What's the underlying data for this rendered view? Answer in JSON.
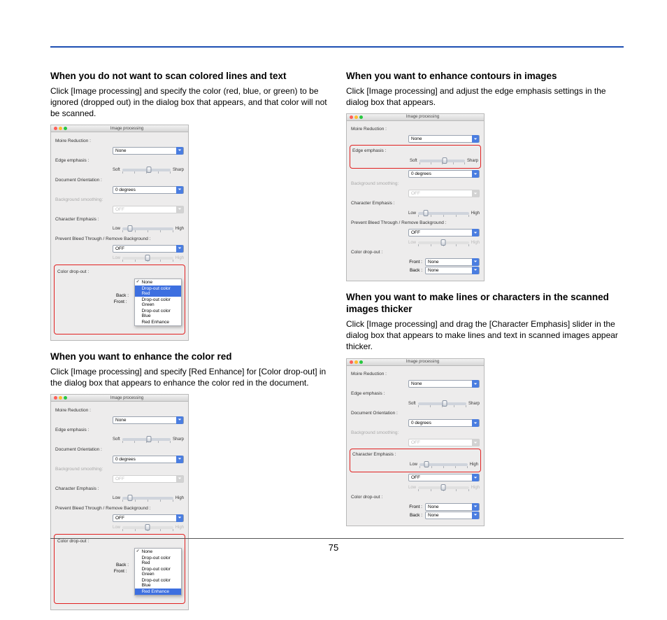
{
  "page_number": "75",
  "left": {
    "sec1": {
      "heading": "When you do not want to scan colored lines and text",
      "body": "Click [Image processing] and specify the color (red, blue, or green) to be ignored (dropped out) in the dialog box that appears, and that color will not be scanned."
    },
    "sec2": {
      "heading": "When you want to enhance the color red",
      "body": "Click [Image processing] and specify [Red Enhance] for [Color drop-out] in the dialog box that appears to enhance the color red in the document."
    }
  },
  "right": {
    "sec1": {
      "heading": "When you want to enhance contours in images",
      "body": "Click [Image processing] and adjust the edge emphasis settings in the dialog box that appears."
    },
    "sec2": {
      "heading": "When you want to make lines or characters in the scanned images thicker",
      "body": "Click [Image processing] and drag the [Character Emphasis] slider in the dialog box that appears to make lines and text in scanned images appear thicker."
    }
  },
  "dialog": {
    "title": "Image processing",
    "moire_label": "Moire Reduction :",
    "moire_value": "None",
    "edge_label": "Edge emphasis :",
    "soft": "Soft",
    "sharp": "Sharp",
    "orient_label": "Document Orientation :",
    "orient_value": "0 degrees",
    "bg_label": "Background smoothing:",
    "bg_value": "OFF",
    "char_label": "Character Emphasis :",
    "low": "Low",
    "high": "High",
    "bleed_label": "Prevent Bleed Through / Remove Background :",
    "bleed_value": "OFF",
    "dropout_label": "Color drop-out :",
    "front_label": "Front :",
    "back_label": "Back :",
    "none": "None",
    "menu": {
      "none": "None",
      "red": "Drop-out color Red",
      "green": "Drop-out color Green",
      "blue": "Drop-out color Blue",
      "enhance": "Red Enhance"
    }
  }
}
